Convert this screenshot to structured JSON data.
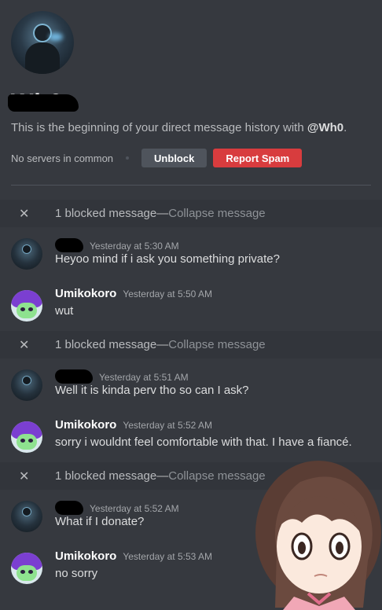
{
  "profile": {
    "username": "Wh0",
    "intro_prefix": "This is the beginning of your direct message history with ",
    "intro_handle": "@Wh0",
    "intro_suffix": "."
  },
  "actions": {
    "no_servers": "No servers in common",
    "unblock": "Unblock",
    "report": "Report Spam"
  },
  "blocked": {
    "text": "1 blocked message",
    "separator": " — ",
    "collapse": "Collapse message"
  },
  "messages": [
    {
      "author": "",
      "time": "Yesterday at 5:30 AM",
      "text": "Heyoo mind if i ask you something private?"
    },
    {
      "author": "Umikokoro",
      "time": "Yesterday at 5:50 AM",
      "text": "wut"
    },
    {
      "author": "",
      "time": "Yesterday at 5:51 AM",
      "text": "Well it is kinda perv tho so can I ask?"
    },
    {
      "author": "Umikokoro",
      "time": "Yesterday at 5:52 AM",
      "text": "sorry i wouldnt feel comfortable with that. I have a fiancé."
    },
    {
      "author": "",
      "time": "Yesterday at 5:52 AM",
      "text": "What if I donate?"
    },
    {
      "author": "Umikokoro",
      "time": "Yesterday at 5:53 AM",
      "text": "no sorry"
    }
  ],
  "colors": {
    "background": "#36393f",
    "danger": "#d83c3e",
    "neutral_button": "#4f545c"
  },
  "icons": {
    "close": "close-icon"
  }
}
